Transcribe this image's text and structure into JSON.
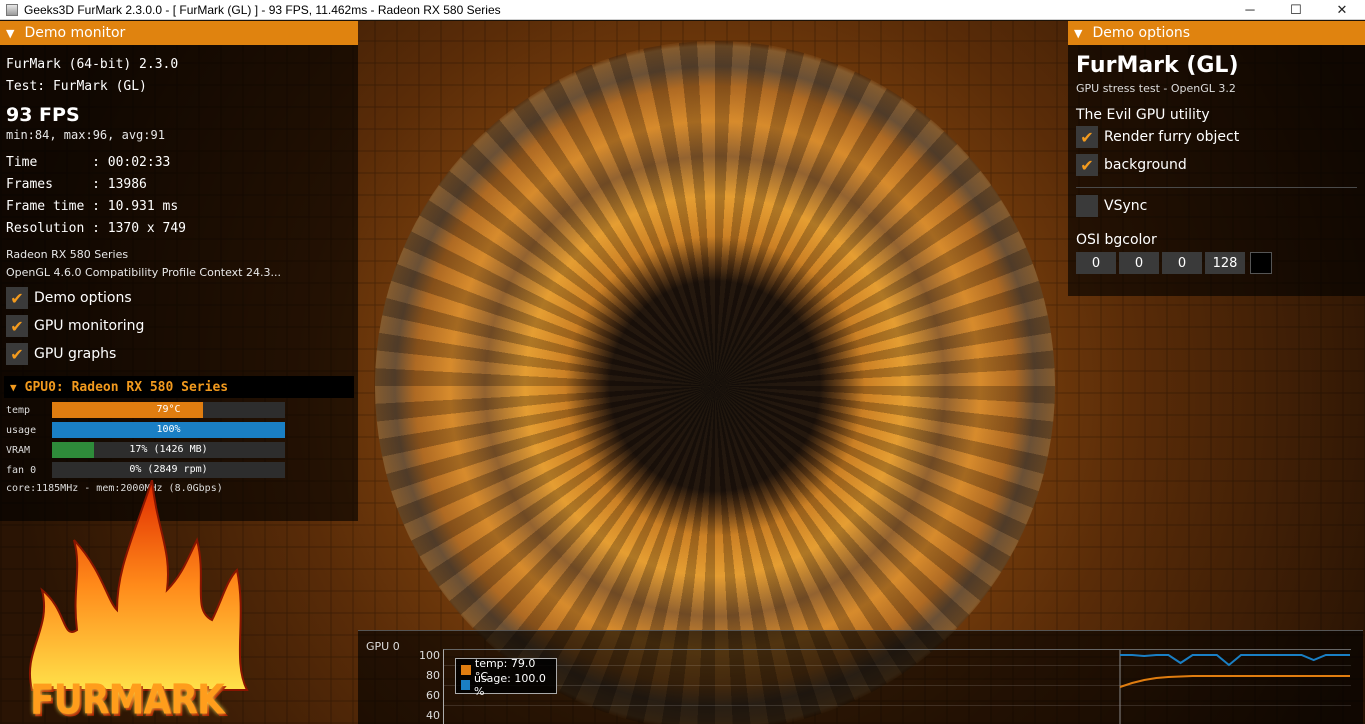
{
  "window": {
    "title": "Geeks3D FurMark 2.3.0.0 - [ FurMark (GL) ] - 93 FPS, 11.462ms - Radeon RX 580 Series",
    "minimize_glyph": "─",
    "maximize_glyph": "☐",
    "close_glyph": "✕"
  },
  "colors": {
    "accent": "#e0830f",
    "temp": "#e07d10",
    "usage": "#1a7fc4",
    "vram": "#2e8b3a"
  },
  "demo_monitor": {
    "header": "Demo monitor",
    "app_line": "FurMark (64-bit) 2.3.0",
    "test_line": "Test: FurMark (GL)",
    "fps": "93 FPS",
    "minmax": "min:84, max:96, avg:91",
    "stats": [
      {
        "label": "Time       ",
        "value": ": 00:02:33"
      },
      {
        "label": "Frames     ",
        "value": ": 13986"
      },
      {
        "label": "Frame time ",
        "value": ": 10.931 ms"
      },
      {
        "label": "Resolution ",
        "value": ": 1370 x 749"
      }
    ],
    "gpu_name": "Radeon RX 580 Series",
    "gl_context": "OpenGL 4.6.0 Compatibility Profile Context 24.3...",
    "checks": [
      {
        "label": "Demo options",
        "checked": true
      },
      {
        "label": "GPU monitoring",
        "checked": true
      },
      {
        "label": "GPU graphs",
        "checked": true
      }
    ]
  },
  "gpu_monitor": {
    "header": "GPU0: Radeon RX 580 Series",
    "rows": [
      {
        "label": "temp",
        "text": "79°C",
        "fill": 0.65,
        "color": "#e07d10"
      },
      {
        "label": "usage",
        "text": "100%",
        "fill": 1.0,
        "color": "#1a7fc4"
      },
      {
        "label": "VRAM",
        "text": "17% (1426 MB)",
        "fill": 0.18,
        "color": "#2e8b3a"
      },
      {
        "label": "fan 0",
        "text": "0% (2849 rpm)",
        "fill": 0.0,
        "color": "#555555"
      }
    ],
    "clock": "core:1185MHz - mem:2000MHz (8.0Gbps)"
  },
  "logo": {
    "text": "FURMARK"
  },
  "demo_options": {
    "header": "Demo options",
    "title": "FurMark (GL)",
    "subtitle": "GPU stress test - OpenGL 3.2",
    "utility": "The Evil GPU utility",
    "checks": [
      {
        "label": "Render furry object",
        "checked": true
      },
      {
        "label": "background",
        "checked": true
      }
    ],
    "vsync": {
      "label": "VSync",
      "checked": false
    },
    "osi_label": "OSI bgcolor",
    "osi_values": [
      "0",
      "0",
      "0",
      "128"
    ],
    "osi_swatch": "#000000"
  },
  "graph": {
    "title": "GPU 0",
    "yticks": [
      "100",
      "80",
      "60",
      "40"
    ],
    "legend": [
      {
        "label": "temp: 79.0 °C",
        "color": "#e07d10"
      },
      {
        "label": "usage: 100.0 %",
        "color": "#1a7fc4"
      }
    ]
  },
  "chart_data": {
    "type": "line",
    "title": "GPU 0",
    "ylim": [
      40,
      100
    ],
    "series": [
      {
        "name": "temp",
        "values": [
          68,
          72,
          75,
          77,
          78,
          78.5,
          79,
          79,
          79,
          79,
          79,
          79,
          79,
          79,
          79,
          79,
          79,
          79,
          79,
          79
        ]
      },
      {
        "name": "usage",
        "values": [
          100,
          100,
          99,
          100,
          100,
          92,
          100,
          100,
          100,
          90,
          100,
          100,
          100,
          100,
          100,
          100,
          95,
          100,
          100,
          100
        ]
      }
    ]
  }
}
